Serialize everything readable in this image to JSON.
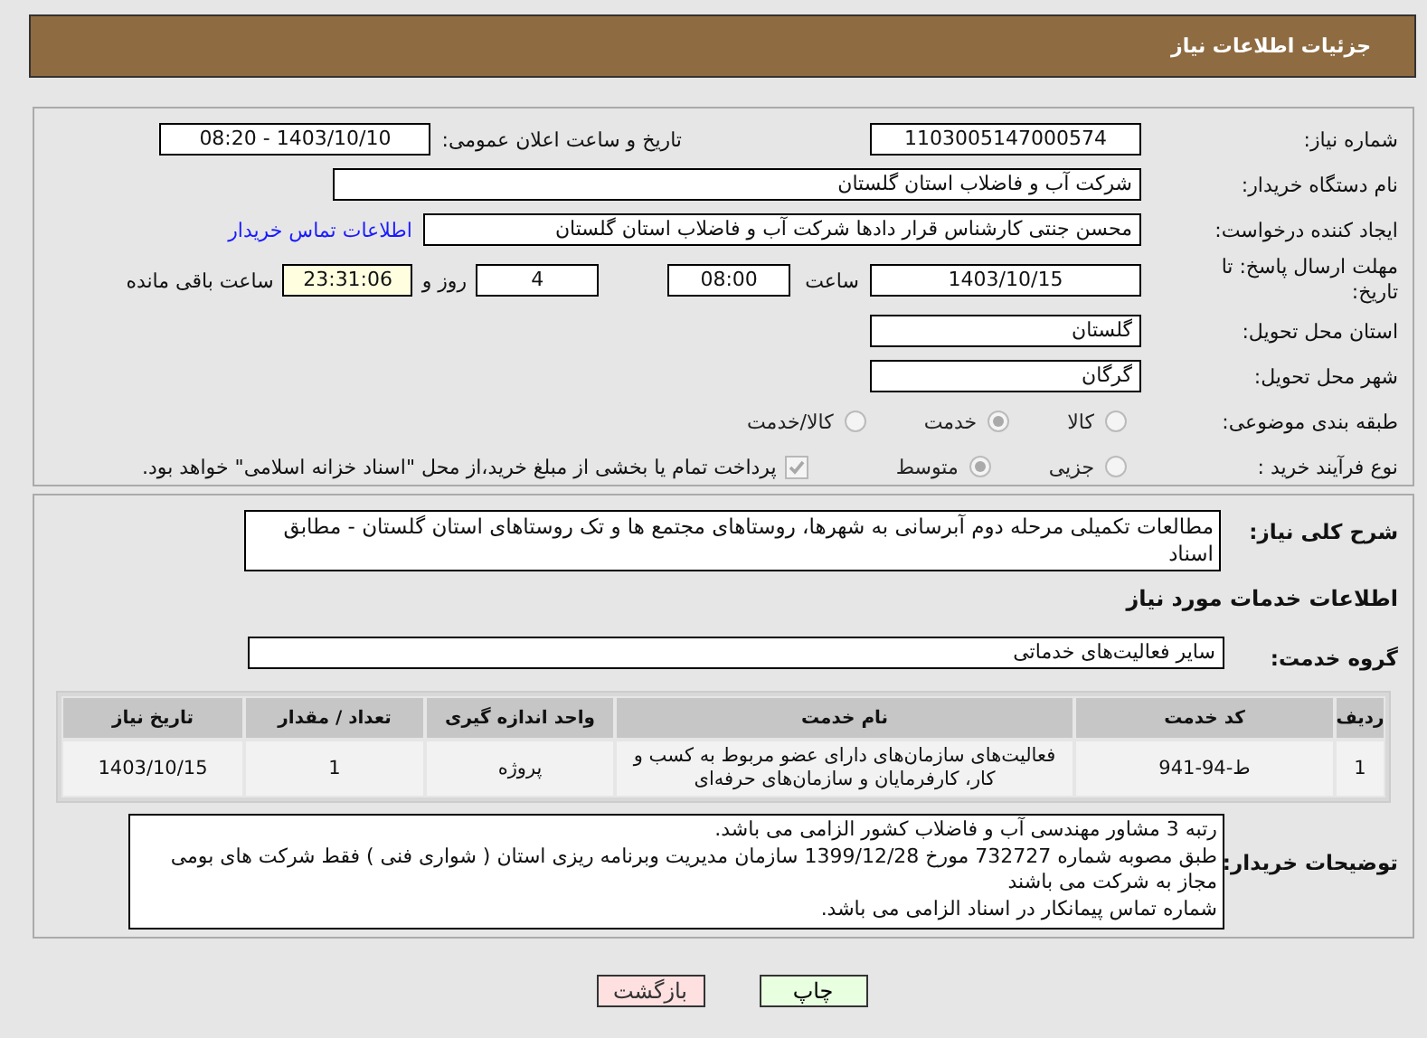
{
  "header": {
    "title": "جزئیات اطلاعات نیاز"
  },
  "need_info": {
    "need_number": {
      "label": "شماره نیاز:",
      "value": "1103005147000574"
    },
    "announce": {
      "label": "تاریخ و ساعت اعلان عمومی:",
      "value": "1403/10/10 - 08:20"
    },
    "buyer_org": {
      "label": "نام دستگاه خریدار:",
      "value": "شرکت آب و فاضلاب استان گلستان"
    },
    "creator": {
      "label": "ایجاد کننده درخواست:",
      "value": "محسن جنتی کارشناس قرار دادها شرکت آب و فاضلاب استان گلستان",
      "link": "اطلاعات تماس خریدار"
    },
    "deadline": {
      "label": "مهلت ارسال پاسخ: تا تاریخ:",
      "date": "1403/10/15",
      "time_label": "ساعت",
      "time": "08:00",
      "days": "4",
      "days_label": "روز و",
      "remaining": "23:31:06",
      "remaining_label": "ساعت باقی مانده"
    },
    "province": {
      "label": "استان محل تحویل:",
      "value": "گلستان"
    },
    "city": {
      "label": "شهر محل تحویل:",
      "value": "گرگان"
    },
    "category": {
      "label": "طبقه بندی موضوعی:",
      "options": [
        {
          "label": "کالا",
          "selected": false
        },
        {
          "label": "خدمت",
          "selected": true
        },
        {
          "label": "کالا/خدمت",
          "selected": false
        }
      ]
    },
    "process": {
      "label": "نوع فرآیند خرید :",
      "options": [
        {
          "label": "جزیی",
          "selected": false
        },
        {
          "label": "متوسط",
          "selected": true
        }
      ],
      "payment": {
        "checked": true,
        "text": "پرداخت تمام یا بخشی از مبلغ خرید،از محل \"اسناد خزانه اسلامی\" خواهد بود."
      }
    }
  },
  "description": {
    "label": "شرح کلی نیاز:",
    "text": "مطالعات تکمیلی مرحله دوم آبرسانی به شهرها، روستاهای مجتمع ها و تک روستاهای استان گلستان - مطابق اسناد"
  },
  "services": {
    "heading": "اطلاعات خدمات مورد نیاز",
    "group_label": "گروه خدمت:",
    "group_value": "سایر فعالیت‌های خدماتی",
    "table": {
      "columns": [
        "ردیف",
        "کد خدمت",
        "نام خدمت",
        "واحد اندازه گیری",
        "تعداد / مقدار",
        "تاریخ نیاز"
      ],
      "rows": [
        [
          "1",
          "ط-94-941",
          "فعالیت‌های سازمان‌های دارای عضو مربوط به کسب و کار، کارفرمایان و سازمان‌های حرفه‌ای",
          "پروژه",
          "1",
          "1403/10/15"
        ]
      ]
    }
  },
  "buyer_notes": {
    "label": "توضیحات خریدار:",
    "lines": [
      "رتبه 3 مشاور مهندسی آب و فاضلاب کشور الزامی می باشد.",
      "طبق مصوبه شماره 732727 مورخ 1399/12/28 سازمان مدیریت وبرنامه ریزی استان ( شواری فنی ) فقط شرکت های بومی مجاز به شرکت می باشند",
      "شماره تماس پیمانکار در اسناد الزامی می باشد."
    ]
  },
  "buttons": [
    {
      "label": "چاپ",
      "kind": "print"
    },
    {
      "label": "بازگشت",
      "kind": "back"
    }
  ]
}
